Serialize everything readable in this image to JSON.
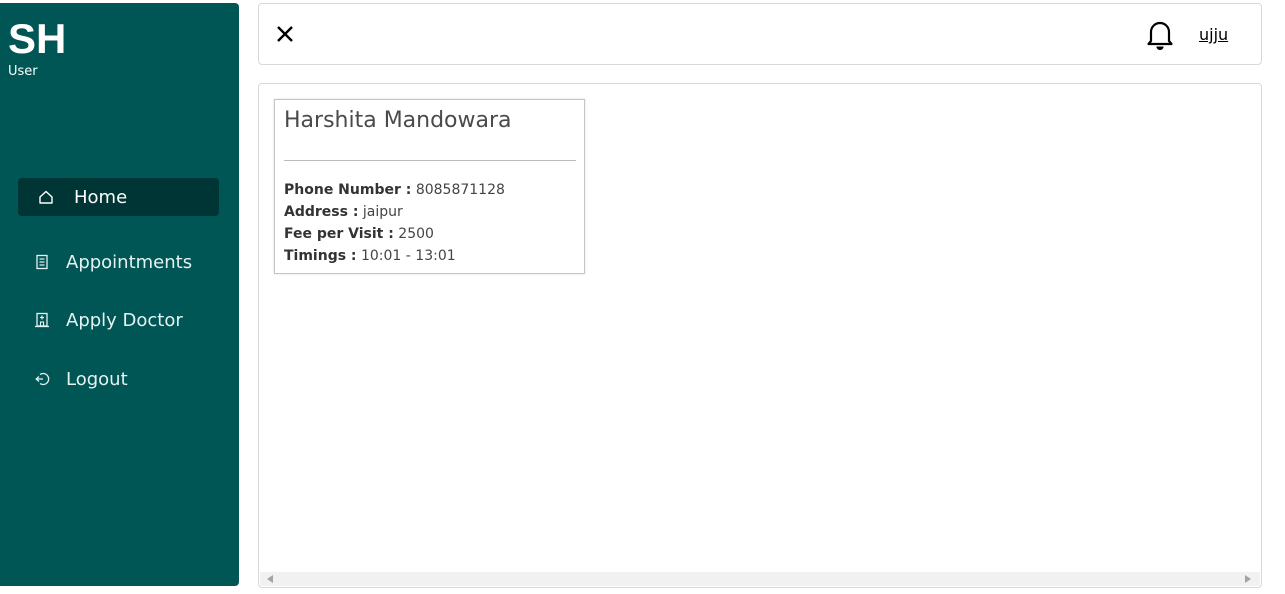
{
  "sidebar": {
    "logo": "SH",
    "role": "User",
    "items": [
      {
        "label": "Home",
        "icon": "home-icon",
        "active": true
      },
      {
        "label": "Appointments",
        "icon": "list-icon",
        "active": false
      },
      {
        "label": "Apply Doctor",
        "icon": "hospital-icon",
        "active": false
      },
      {
        "label": "Logout",
        "icon": "logout-icon",
        "active": false
      }
    ]
  },
  "header": {
    "close_icon": "close-icon",
    "notification_icon": "bell-icon",
    "user_name": "ujju"
  },
  "doctors": [
    {
      "name": "Harshita Mandowara",
      "phone_label": "Phone Number :",
      "phone": "8085871128",
      "address_label": "Address :",
      "address": "jaipur",
      "fee_label": "Fee per Visit :",
      "fee": "2500",
      "timings_label": "Timings :",
      "timings": "10:01 - 13:01"
    }
  ],
  "colors": {
    "sidebar_bg": "#005555",
    "active_item_bg": "#003535"
  }
}
